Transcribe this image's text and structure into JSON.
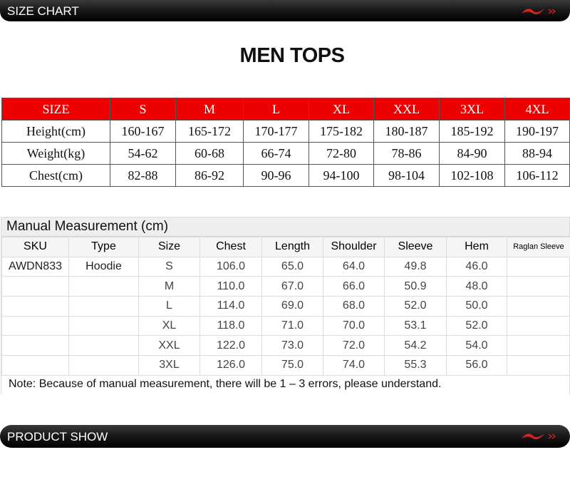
{
  "banners": {
    "top": "SIZE CHART",
    "bottom": "PRODUCT SHOW"
  },
  "title": "MEN TOPS",
  "size_chart": {
    "header": [
      "SIZE",
      "S",
      "M",
      "L",
      "XL",
      "XXL",
      "3XL",
      "4XL"
    ],
    "rows": [
      [
        "Height(cm)",
        "160-167",
        "165-172",
        "170-177",
        "175-182",
        "180-187",
        "185-192",
        "190-197"
      ],
      [
        "Weight(kg)",
        "54-62",
        "60-68",
        "66-74",
        "72-80",
        "78-86",
        "84-90",
        "88-94"
      ],
      [
        "Chest(cm)",
        "82-88",
        "86-92",
        "90-96",
        "94-100",
        "98-104",
        "102-108",
        "106-112"
      ]
    ]
  },
  "manual": {
    "title": "Manual Measurement (cm)",
    "headers": [
      "SKU",
      "Type",
      "Size",
      "Chest",
      "Length",
      "Shoulder",
      "Sleeve",
      "Hem",
      "Raglan Sleeve"
    ],
    "rows": [
      [
        "AWDN833",
        "Hoodie",
        "S",
        "106.0",
        "65.0",
        "64.0",
        "49.8",
        "46.0",
        ""
      ],
      [
        "",
        "",
        "M",
        "110.0",
        "67.0",
        "66.0",
        "50.9",
        "48.0",
        ""
      ],
      [
        "",
        "",
        "L",
        "114.0",
        "69.0",
        "68.0",
        "52.0",
        "50.0",
        ""
      ],
      [
        "",
        "",
        "XL",
        "118.0",
        "71.0",
        "70.0",
        "53.1",
        "52.0",
        ""
      ],
      [
        "",
        "",
        "XXL",
        "122.0",
        "73.0",
        "72.0",
        "54.2",
        "54.0",
        ""
      ],
      [
        "",
        "",
        "3XL",
        "126.0",
        "75.0",
        "74.0",
        "55.3",
        "56.0",
        ""
      ]
    ],
    "note": "Note: Because of manual measurement, there will be 1 – 3 errors, please understand."
  },
  "colors": {
    "header_red": "#ee0000",
    "logo_red": "#e02020",
    "banner": "#111111"
  },
  "icons": {
    "brand_logo": "li-ning-swoosh-icon"
  }
}
